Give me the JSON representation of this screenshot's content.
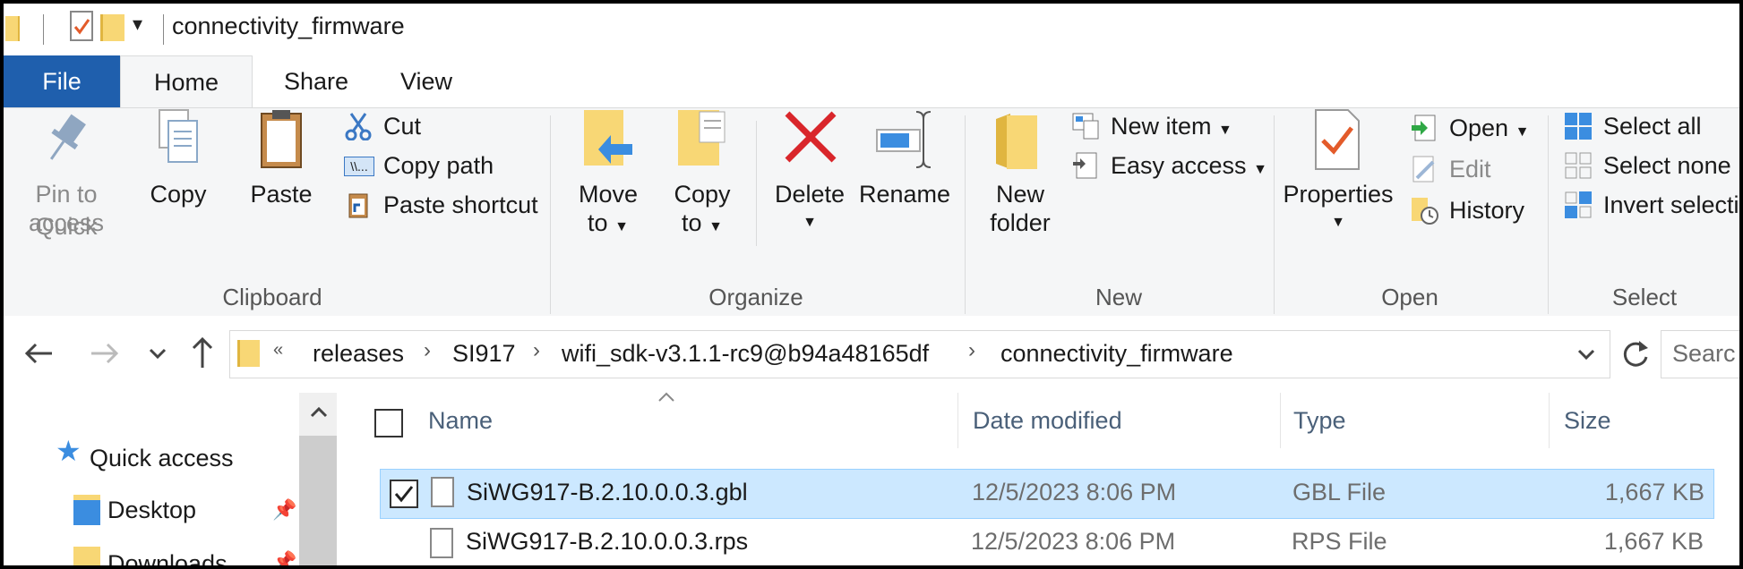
{
  "window": {
    "title": "connectivity_firmware"
  },
  "tabs": [
    "File",
    "Home",
    "Share",
    "View"
  ],
  "ribbon": {
    "clipboard": {
      "label": "Clipboard",
      "pin_line1": "Pin to Quick",
      "pin_line2": "access",
      "copy": "Copy",
      "paste": "Paste",
      "cut": "Cut",
      "copy_path": "Copy path",
      "paste_shortcut": "Paste shortcut"
    },
    "organize": {
      "label": "Organize",
      "move_line1": "Move",
      "move_line2": "to",
      "copy_line1": "Copy",
      "copy_line2": "to",
      "delete": "Delete",
      "rename": "Rename"
    },
    "new": {
      "label": "New",
      "folder_line1": "New",
      "folder_line2": "folder",
      "new_item": "New item",
      "easy_access": "Easy access"
    },
    "open": {
      "label": "Open",
      "properties": "Properties",
      "open": "Open",
      "edit": "Edit",
      "history": "History"
    },
    "select": {
      "label": "Select",
      "select_all": "Select all",
      "select_none": "Select none",
      "invert": "Invert selectio"
    }
  },
  "address": {
    "overflow": "«",
    "crumbs": [
      "releases",
      "SI917",
      "wifi_sdk-v3.1.1-rc9@b94a48165df",
      "connectivity_firmware"
    ],
    "search_placeholder": "Searc"
  },
  "navpane": {
    "quick_access": "Quick access",
    "desktop": "Desktop",
    "downloads": "Downloads"
  },
  "columns": {
    "name": "Name",
    "date": "Date modified",
    "type": "Type",
    "size": "Size"
  },
  "files": [
    {
      "name": "SiWG917-B.2.10.0.0.3.gbl",
      "date": "12/5/2023 8:06 PM",
      "type": "GBL File",
      "size": "1,667 KB",
      "selected": true
    },
    {
      "name": "SiWG917-B.2.10.0.0.3.rps",
      "date": "12/5/2023 8:06 PM",
      "type": "RPS File",
      "size": "1,667 KB",
      "selected": false
    }
  ],
  "colors": {
    "file_tab": "#1f5fad",
    "selection": "#cce8ff",
    "folder": "#f8d775",
    "delete_red": "#d9262b"
  }
}
